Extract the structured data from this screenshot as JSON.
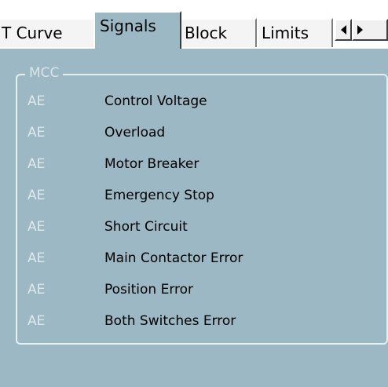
{
  "tabs": [
    {
      "label": "T Curve",
      "active": false
    },
    {
      "label": "Signals",
      "active": true
    },
    {
      "label": "Block",
      "active": false
    },
    {
      "label": "Limits",
      "active": false
    }
  ],
  "tab_scroll": {
    "left_icon": "triangle-left-icon",
    "right_icon": "triangle-right-icon"
  },
  "group": {
    "title": "MCC",
    "signals": [
      {
        "code": "AE",
        "label": "Control Voltage"
      },
      {
        "code": "AE",
        "label": "Overload"
      },
      {
        "code": "AE",
        "label": "Motor Breaker"
      },
      {
        "code": "AE",
        "label": "Emergency Stop"
      },
      {
        "code": "AE",
        "label": "Short Circuit"
      },
      {
        "code": "AE",
        "label": "Main Contactor Error"
      },
      {
        "code": "AE",
        "label": "Position Error"
      },
      {
        "code": "AE",
        "label": "Both Switches Error"
      }
    ]
  },
  "colors": {
    "panel": "#9bb8c4",
    "tab_inactive": "#f4f4f4",
    "code_text": "#dfe8ec",
    "label_text": "#000000"
  }
}
